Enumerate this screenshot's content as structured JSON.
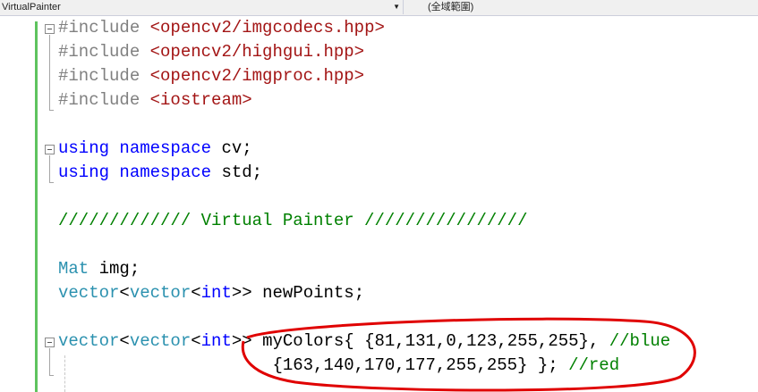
{
  "navbar": {
    "project_name": "VirtualPainter",
    "scope": "(全域範圍)"
  },
  "code": {
    "lines": [
      {
        "tokens": [
          {
            "t": "#include ",
            "c": "pp"
          },
          {
            "t": "<opencv2/imgcodecs.hpp>",
            "c": "str"
          }
        ]
      },
      {
        "tokens": [
          {
            "t": "#include ",
            "c": "pp"
          },
          {
            "t": "<opencv2/highgui.hpp>",
            "c": "str"
          }
        ]
      },
      {
        "tokens": [
          {
            "t": "#include ",
            "c": "pp"
          },
          {
            "t": "<opencv2/imgproc.hpp>",
            "c": "str"
          }
        ]
      },
      {
        "tokens": [
          {
            "t": "#include ",
            "c": "pp"
          },
          {
            "t": "<iostream>",
            "c": "str"
          }
        ]
      },
      {
        "tokens": []
      },
      {
        "tokens": [
          {
            "t": "using",
            "c": "kw"
          },
          {
            "t": " "
          },
          {
            "t": "namespace",
            "c": "kw"
          },
          {
            "t": " cv;"
          }
        ]
      },
      {
        "tokens": [
          {
            "t": "using",
            "c": "kw"
          },
          {
            "t": " "
          },
          {
            "t": "namespace",
            "c": "kw"
          },
          {
            "t": " std;"
          }
        ]
      },
      {
        "tokens": []
      },
      {
        "tokens": [
          {
            "t": "///////////// Virtual Painter ////////////////",
            "c": "cm"
          }
        ]
      },
      {
        "tokens": []
      },
      {
        "tokens": [
          {
            "t": "Mat",
            "c": "ty"
          },
          {
            "t": " img;"
          }
        ]
      },
      {
        "tokens": [
          {
            "t": "vector",
            "c": "ty"
          },
          {
            "t": "<"
          },
          {
            "t": "vector",
            "c": "ty"
          },
          {
            "t": "<"
          },
          {
            "t": "int",
            "c": "kw"
          },
          {
            "t": ">> newPoints;"
          }
        ]
      },
      {
        "tokens": []
      },
      {
        "tokens": [
          {
            "t": "vector",
            "c": "ty"
          },
          {
            "t": "<"
          },
          {
            "t": "vector",
            "c": "ty"
          },
          {
            "t": "<"
          },
          {
            "t": "int",
            "c": "kw"
          },
          {
            "t": ">> myColors{ {81,131,0,123,255,255}, "
          },
          {
            "t": "//blue",
            "c": "cm"
          }
        ]
      },
      {
        "tokens": [
          {
            "t": "                     {163,140,170,177,255,255} }; "
          },
          {
            "t": "//red",
            "c": "cm"
          }
        ]
      }
    ]
  },
  "colors": {
    "annotation": "#e00000"
  }
}
